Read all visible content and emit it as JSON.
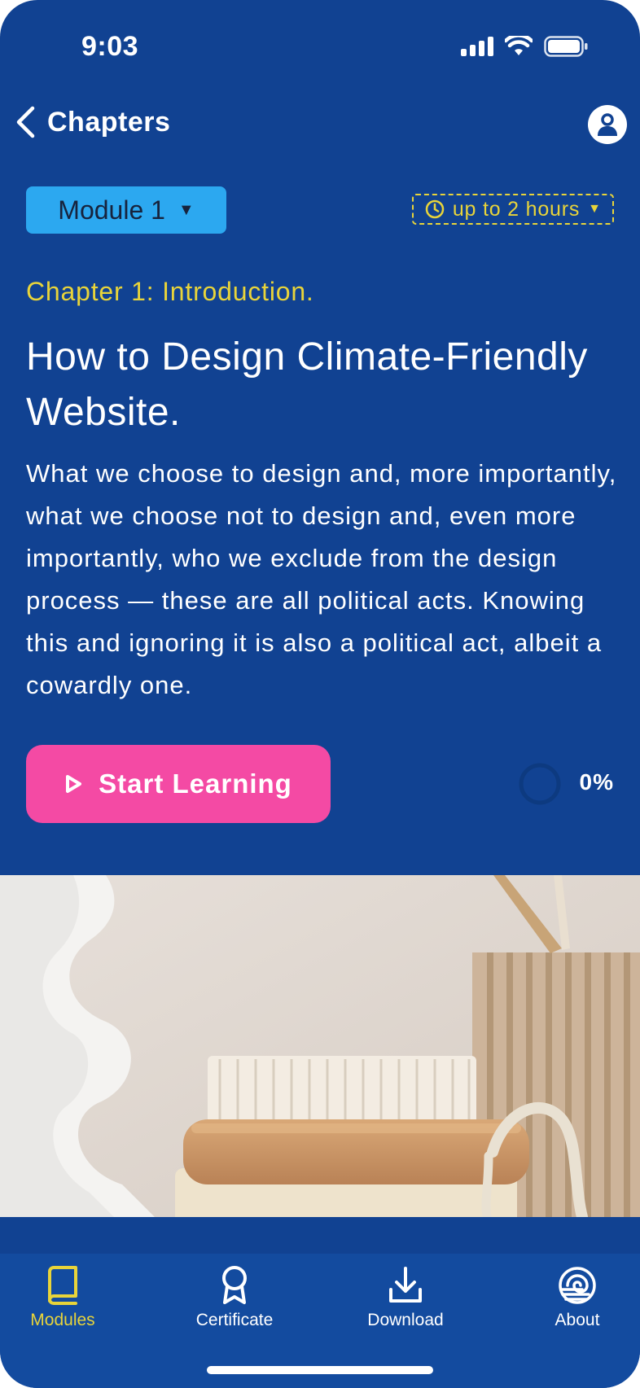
{
  "status_bar": {
    "time": "9:03"
  },
  "nav": {
    "back_label": "Chapters"
  },
  "module": {
    "label": "Module 1"
  },
  "duration": {
    "label": "up to 2 hours"
  },
  "chapter": {
    "label": "Chapter 1: Introduction.",
    "title": "How to Design Climate-Friendly Website.",
    "description": "What we choose to design and, more importantly, what we choose not to design and, even more importantly, who we exclude from the design process — these are all political acts. Knowing this and ignoring it is also a political act, albeit a cowardly one."
  },
  "cta": {
    "label": "Start Learning"
  },
  "progress": {
    "value": 0,
    "label": "0%"
  },
  "tabs": [
    {
      "label": "Modules",
      "icon": "book-icon",
      "active": true
    },
    {
      "label": "Certificate",
      "icon": "award-icon",
      "active": false
    },
    {
      "label": "Download",
      "icon": "download-icon",
      "active": false
    },
    {
      "label": "About",
      "icon": "spiral-icon",
      "active": false
    }
  ],
  "colors": {
    "background": "#114292",
    "accent_yellow": "#e8d43a",
    "module_blue": "#2ca8f0",
    "cta_pink": "#f44aa4",
    "tabbar": "#134b9f"
  }
}
